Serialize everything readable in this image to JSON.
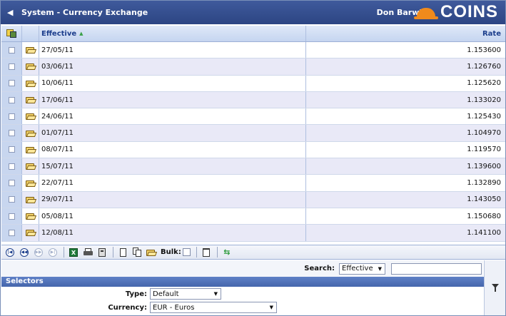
{
  "header": {
    "title": "System - Currency Exchange",
    "user": "Don Barwick",
    "logo_text": "COINS"
  },
  "grid": {
    "columns": {
      "effective": "Effective",
      "rate": "Rate"
    },
    "rows": [
      {
        "effective": "27/05/11",
        "rate": "1.153600"
      },
      {
        "effective": "03/06/11",
        "rate": "1.126760"
      },
      {
        "effective": "10/06/11",
        "rate": "1.125620"
      },
      {
        "effective": "17/06/11",
        "rate": "1.133020"
      },
      {
        "effective": "24/06/11",
        "rate": "1.125430"
      },
      {
        "effective": "01/07/11",
        "rate": "1.104970"
      },
      {
        "effective": "08/07/11",
        "rate": "1.119570"
      },
      {
        "effective": "15/07/11",
        "rate": "1.139600"
      },
      {
        "effective": "22/07/11",
        "rate": "1.132890"
      },
      {
        "effective": "29/07/11",
        "rate": "1.143050"
      },
      {
        "effective": "05/08/11",
        "rate": "1.150680"
      },
      {
        "effective": "12/08/11",
        "rate": "1.141100"
      }
    ]
  },
  "toolbar": {
    "bulk_label": "Bulk:"
  },
  "search": {
    "label": "Search:",
    "field": "Effective",
    "value": ""
  },
  "selectors": {
    "title": "Selectors",
    "type_label": "Type:",
    "type_value": "Default",
    "currency_label": "Currency:",
    "currency_value": "EUR - Euros"
  }
}
